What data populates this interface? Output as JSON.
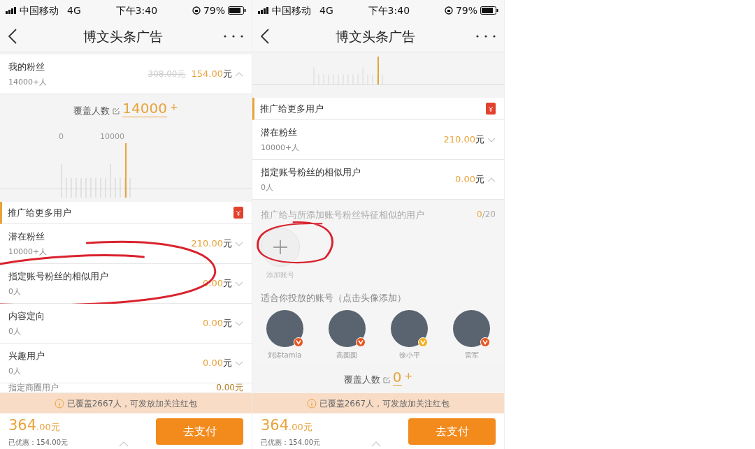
{
  "screens": [
    {
      "status_bar": {
        "carrier": "中国移动",
        "network": "4G",
        "time": "下午3:40",
        "battery": "79%"
      },
      "title": "博文头条广告",
      "blocks": [
        {
          "kind": "row",
          "label": "我的粉丝",
          "sub": "14000+人",
          "old_price": "308.00元",
          "price": "154.00",
          "unit": "元",
          "expanded": true,
          "annotated": false,
          "faded": false
        },
        {
          "kind": "coverage",
          "label": "覆盖人数",
          "value": "14000",
          "suffix": "+"
        },
        {
          "kind": "histogram",
          "tick_labels": [
            "0",
            "10000"
          ]
        },
        {
          "kind": "section_header",
          "title": "推广给更多用户"
        },
        {
          "kind": "row",
          "label": "潜在粉丝",
          "sub": "10000+人",
          "price": "210.00",
          "unit": "元",
          "expanded": false,
          "annotated": false,
          "faded": false
        },
        {
          "kind": "row",
          "label": "指定账号粉丝的相似用户",
          "sub": "0人",
          "price": "0.00",
          "unit": "元",
          "expanded": false,
          "annotated": true,
          "faded": false
        },
        {
          "kind": "row",
          "label": "内容定向",
          "sub": "0人",
          "price": "0.00",
          "unit": "元",
          "expanded": false,
          "annotated": false,
          "faded": false
        },
        {
          "kind": "row",
          "label": "兴趣用户",
          "sub": "0人",
          "price": "0.00",
          "unit": "元",
          "expanded": false,
          "annotated": false,
          "faded": false
        },
        {
          "kind": "row",
          "label": "指定商圈用户",
          "price": "0.00",
          "unit": "元",
          "faded": true
        }
      ],
      "banner": "已覆盖2667人，可发放加关注红包",
      "footer": {
        "total": "364",
        "total_tail": ".00元",
        "discount": "已优惠：154.00元",
        "pay": "去支付"
      }
    },
    {
      "status_bar": {
        "carrier": "中国移动",
        "network": "4G",
        "time": "下午3:40",
        "battery": "79%"
      },
      "title": "博文头条广告",
      "blocks": [
        {
          "kind": "histogram"
        },
        {
          "kind": "section_header",
          "title": "推广给更多用户"
        },
        {
          "kind": "row",
          "label": "潜在粉丝",
          "sub": "10000+人",
          "price": "210.00",
          "unit": "元",
          "expanded": false,
          "annotated": false,
          "faded": false
        },
        {
          "kind": "row",
          "label": "指定账号粉丝的相似用户",
          "sub": "0人",
          "price": "0.00",
          "unit": "元",
          "expanded": true,
          "annotated": false,
          "faded": false
        },
        {
          "kind": "similar",
          "prompt": "推广给与所添加账号粉丝特征相似的用户",
          "count": "0",
          "limit": "/20",
          "add_label": "添加账号",
          "annotated": true,
          "suggest_title": "适合你投放的账号（点击头像添加）",
          "accounts": [
            {
              "name": "刘涛tamia",
              "color": "#e8541e"
            },
            {
              "name": "高圆圆",
              "color": "#e8541e"
            },
            {
              "name": "徐小平",
              "color": "#f2b01e"
            },
            {
              "name": "雷军",
              "color": "#e8541e"
            }
          ]
        },
        {
          "kind": "coverage",
          "label": "覆盖人数",
          "value": "0",
          "suffix": "+"
        }
      ],
      "banner": "已覆盖2667人，可发放加关注红包",
      "footer": {
        "total": "364",
        "total_tail": ".00元",
        "discount": "已优惠：154.00元",
        "pay": "去支付"
      }
    }
  ]
}
